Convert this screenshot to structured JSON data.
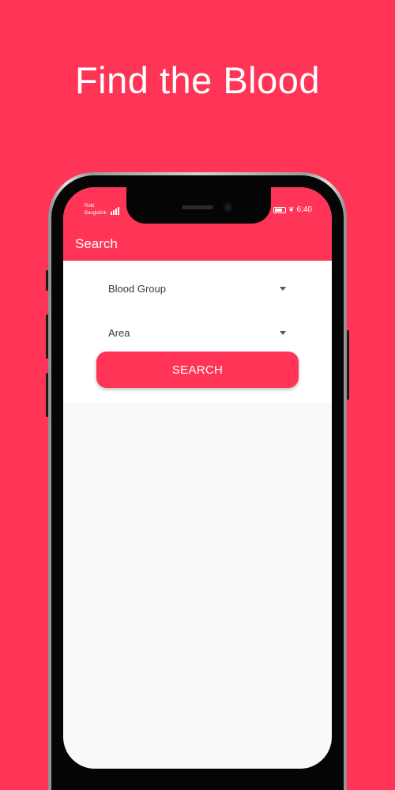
{
  "headline": "Find the Blood",
  "status_bar": {
    "carrier_line1": "Robi",
    "carrier_line2": "Banglalink",
    "time": "6:40",
    "icons": [
      "signal-icon",
      "battery-icon",
      "leaf-icon"
    ]
  },
  "appbar": {
    "title": "Search"
  },
  "form": {
    "blood_group_label": "Blood Group",
    "area_label": "Area",
    "search_button": "SEARCH"
  },
  "colors": {
    "brand": "#FF3456",
    "background_panel": "#F9F9F9"
  }
}
